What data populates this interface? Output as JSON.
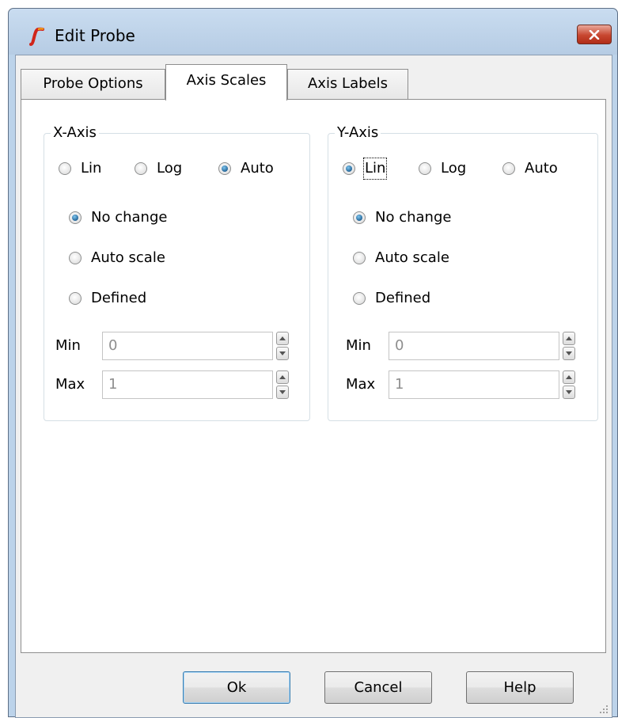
{
  "window": {
    "title": "Edit Probe",
    "close_symbol": "×"
  },
  "tabs": [
    {
      "label": "Probe Options",
      "active": false
    },
    {
      "label": "Axis Scales",
      "active": true
    },
    {
      "label": "Axis Labels",
      "active": false
    }
  ],
  "x_axis": {
    "title": "X-Axis",
    "scale_options": [
      {
        "label": "Lin",
        "checked": false
      },
      {
        "label": "Log",
        "checked": false
      },
      {
        "label": "Auto",
        "checked": true
      }
    ],
    "range_options": [
      {
        "label": "No change",
        "checked": true
      },
      {
        "label": "Auto scale",
        "checked": false
      },
      {
        "label": "Defined",
        "checked": false
      }
    ],
    "min_label": "Min",
    "min_value": "0",
    "max_label": "Max",
    "max_value": "1"
  },
  "y_axis": {
    "title": "Y-Axis",
    "scale_options": [
      {
        "label": "Lin",
        "checked": true
      },
      {
        "label": "Log",
        "checked": false
      },
      {
        "label": "Auto",
        "checked": false
      }
    ],
    "range_options": [
      {
        "label": "No change",
        "checked": true
      },
      {
        "label": "Auto scale",
        "checked": false
      },
      {
        "label": "Defined",
        "checked": false
      }
    ],
    "min_label": "Min",
    "min_value": "0",
    "max_label": "Max",
    "max_value": "1"
  },
  "buttons": {
    "ok": "Ok",
    "cancel": "Cancel",
    "help": "Help"
  },
  "colors": {
    "window_frame": "#bcd3ea",
    "close_button": "#c7462f",
    "radio_checked": "#1e5f92",
    "default_button_border": "#3c7fb1"
  }
}
